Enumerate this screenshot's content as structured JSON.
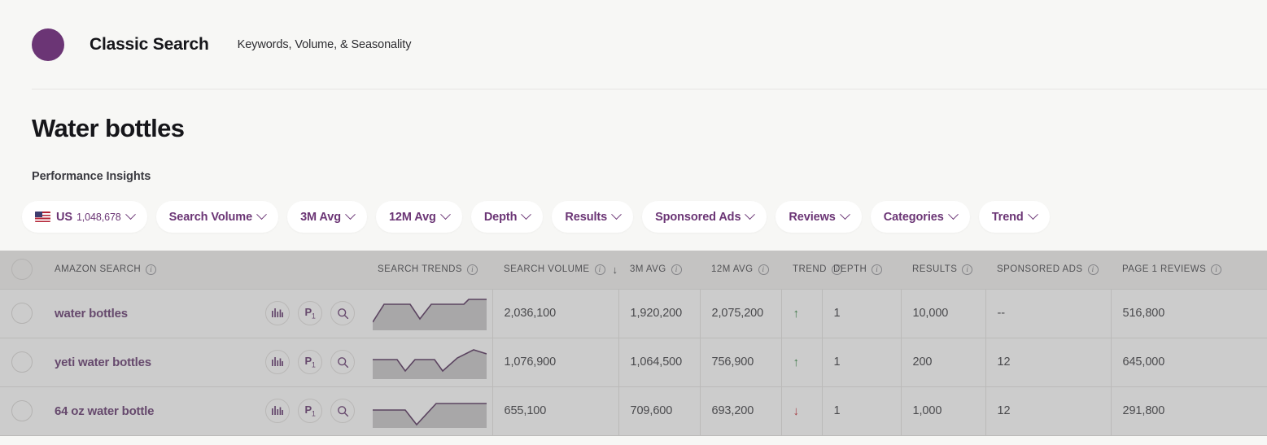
{
  "topbar": {
    "app_title": "Classic Search",
    "subtitle": "Keywords, Volume, & Seasonality",
    "logo_color": "#6b3575"
  },
  "page": {
    "title": "Water bottles",
    "section_label": "Performance Insights"
  },
  "filters": [
    {
      "label": "US",
      "sub": "1,048,678",
      "icon": "us-flag-icon",
      "name": "filter-country"
    },
    {
      "label": "Search Volume",
      "sub": "",
      "icon": "",
      "name": "filter-search-volume"
    },
    {
      "label": "3M Avg",
      "sub": "",
      "icon": "",
      "name": "filter-3m-avg"
    },
    {
      "label": "12M Avg",
      "sub": "",
      "icon": "",
      "name": "filter-12m-avg"
    },
    {
      "label": "Depth",
      "sub": "",
      "icon": "",
      "name": "filter-depth"
    },
    {
      "label": "Results",
      "sub": "",
      "icon": "",
      "name": "filter-results"
    },
    {
      "label": "Sponsored Ads",
      "sub": "",
      "icon": "",
      "name": "filter-sponsored-ads"
    },
    {
      "label": "Reviews",
      "sub": "",
      "icon": "",
      "name": "filter-reviews"
    },
    {
      "label": "Categories",
      "sub": "",
      "icon": "",
      "name": "filter-categories"
    },
    {
      "label": "Trend",
      "sub": "",
      "icon": "",
      "name": "filter-trend"
    }
  ],
  "table": {
    "columns": [
      {
        "label": "AMAZON SEARCH",
        "info": true,
        "sorted": false
      },
      {
        "label": "SEARCH TRENDS",
        "info": true,
        "sorted": false
      },
      {
        "label": "SEARCH VOLUME",
        "info": true,
        "sorted": true,
        "sort_dir": "↓"
      },
      {
        "label": "3M AVG",
        "info": true,
        "sorted": false
      },
      {
        "label": "12M AVG",
        "info": true,
        "sorted": false
      },
      {
        "label": "TREND",
        "info": true,
        "sorted": false
      },
      {
        "label": "DEPTH",
        "info": true,
        "sorted": false
      },
      {
        "label": "RESULTS",
        "info": true,
        "sorted": false
      },
      {
        "label": "SPONSORED ADS",
        "info": true,
        "sorted": false
      },
      {
        "label": "PAGE 1 REVIEWS",
        "info": true,
        "sorted": false
      }
    ],
    "row_actions": [
      {
        "name": "bar-chart-icon",
        "label": ""
      },
      {
        "name": "page-one-badge",
        "label": "P",
        "sub": "1"
      },
      {
        "name": "search-icon",
        "label": ""
      }
    ],
    "rows": [
      {
        "keyword": "water bottles",
        "search_volume": "2,036,100",
        "avg_3m": "1,920,200",
        "avg_12m": "2,075,200",
        "trend": "up",
        "trend_glyph": "↑",
        "depth": "1",
        "results": "10,000",
        "sponsored_ads": "--",
        "page1_reviews": "516,800",
        "sparkline": "0,34 14,12 46,12 58,30 72,12 112,12 118,6 140,6"
      },
      {
        "keyword": "yeti water bottles",
        "search_volume": "1,076,900",
        "avg_3m": "1,064,500",
        "avg_12m": "756,900",
        "trend": "up",
        "trend_glyph": "↑",
        "depth": "1",
        "results": "200",
        "sponsored_ads": "12",
        "page1_reviews": "645,000",
        "sparkline": "0,20 30,20 40,34 52,20 76,20 86,34 104,18 124,8 140,13"
      },
      {
        "keyword": "64 oz water bottle",
        "search_volume": "655,100",
        "avg_3m": "709,600",
        "avg_12m": "693,200",
        "trend": "down",
        "trend_glyph": "↓",
        "depth": "1",
        "results": "1,000",
        "sponsored_ads": "12",
        "page1_reviews": "291,800",
        "sparkline": "0,22 40,22 54,40 78,14 140,14"
      }
    ]
  },
  "colors": {
    "accent_purple": "#6b3575",
    "link_purple": "#5b2d66",
    "trend_up": "#1f7a2e",
    "trend_down": "#c0202a",
    "page_bg": "#f7f7f5"
  }
}
